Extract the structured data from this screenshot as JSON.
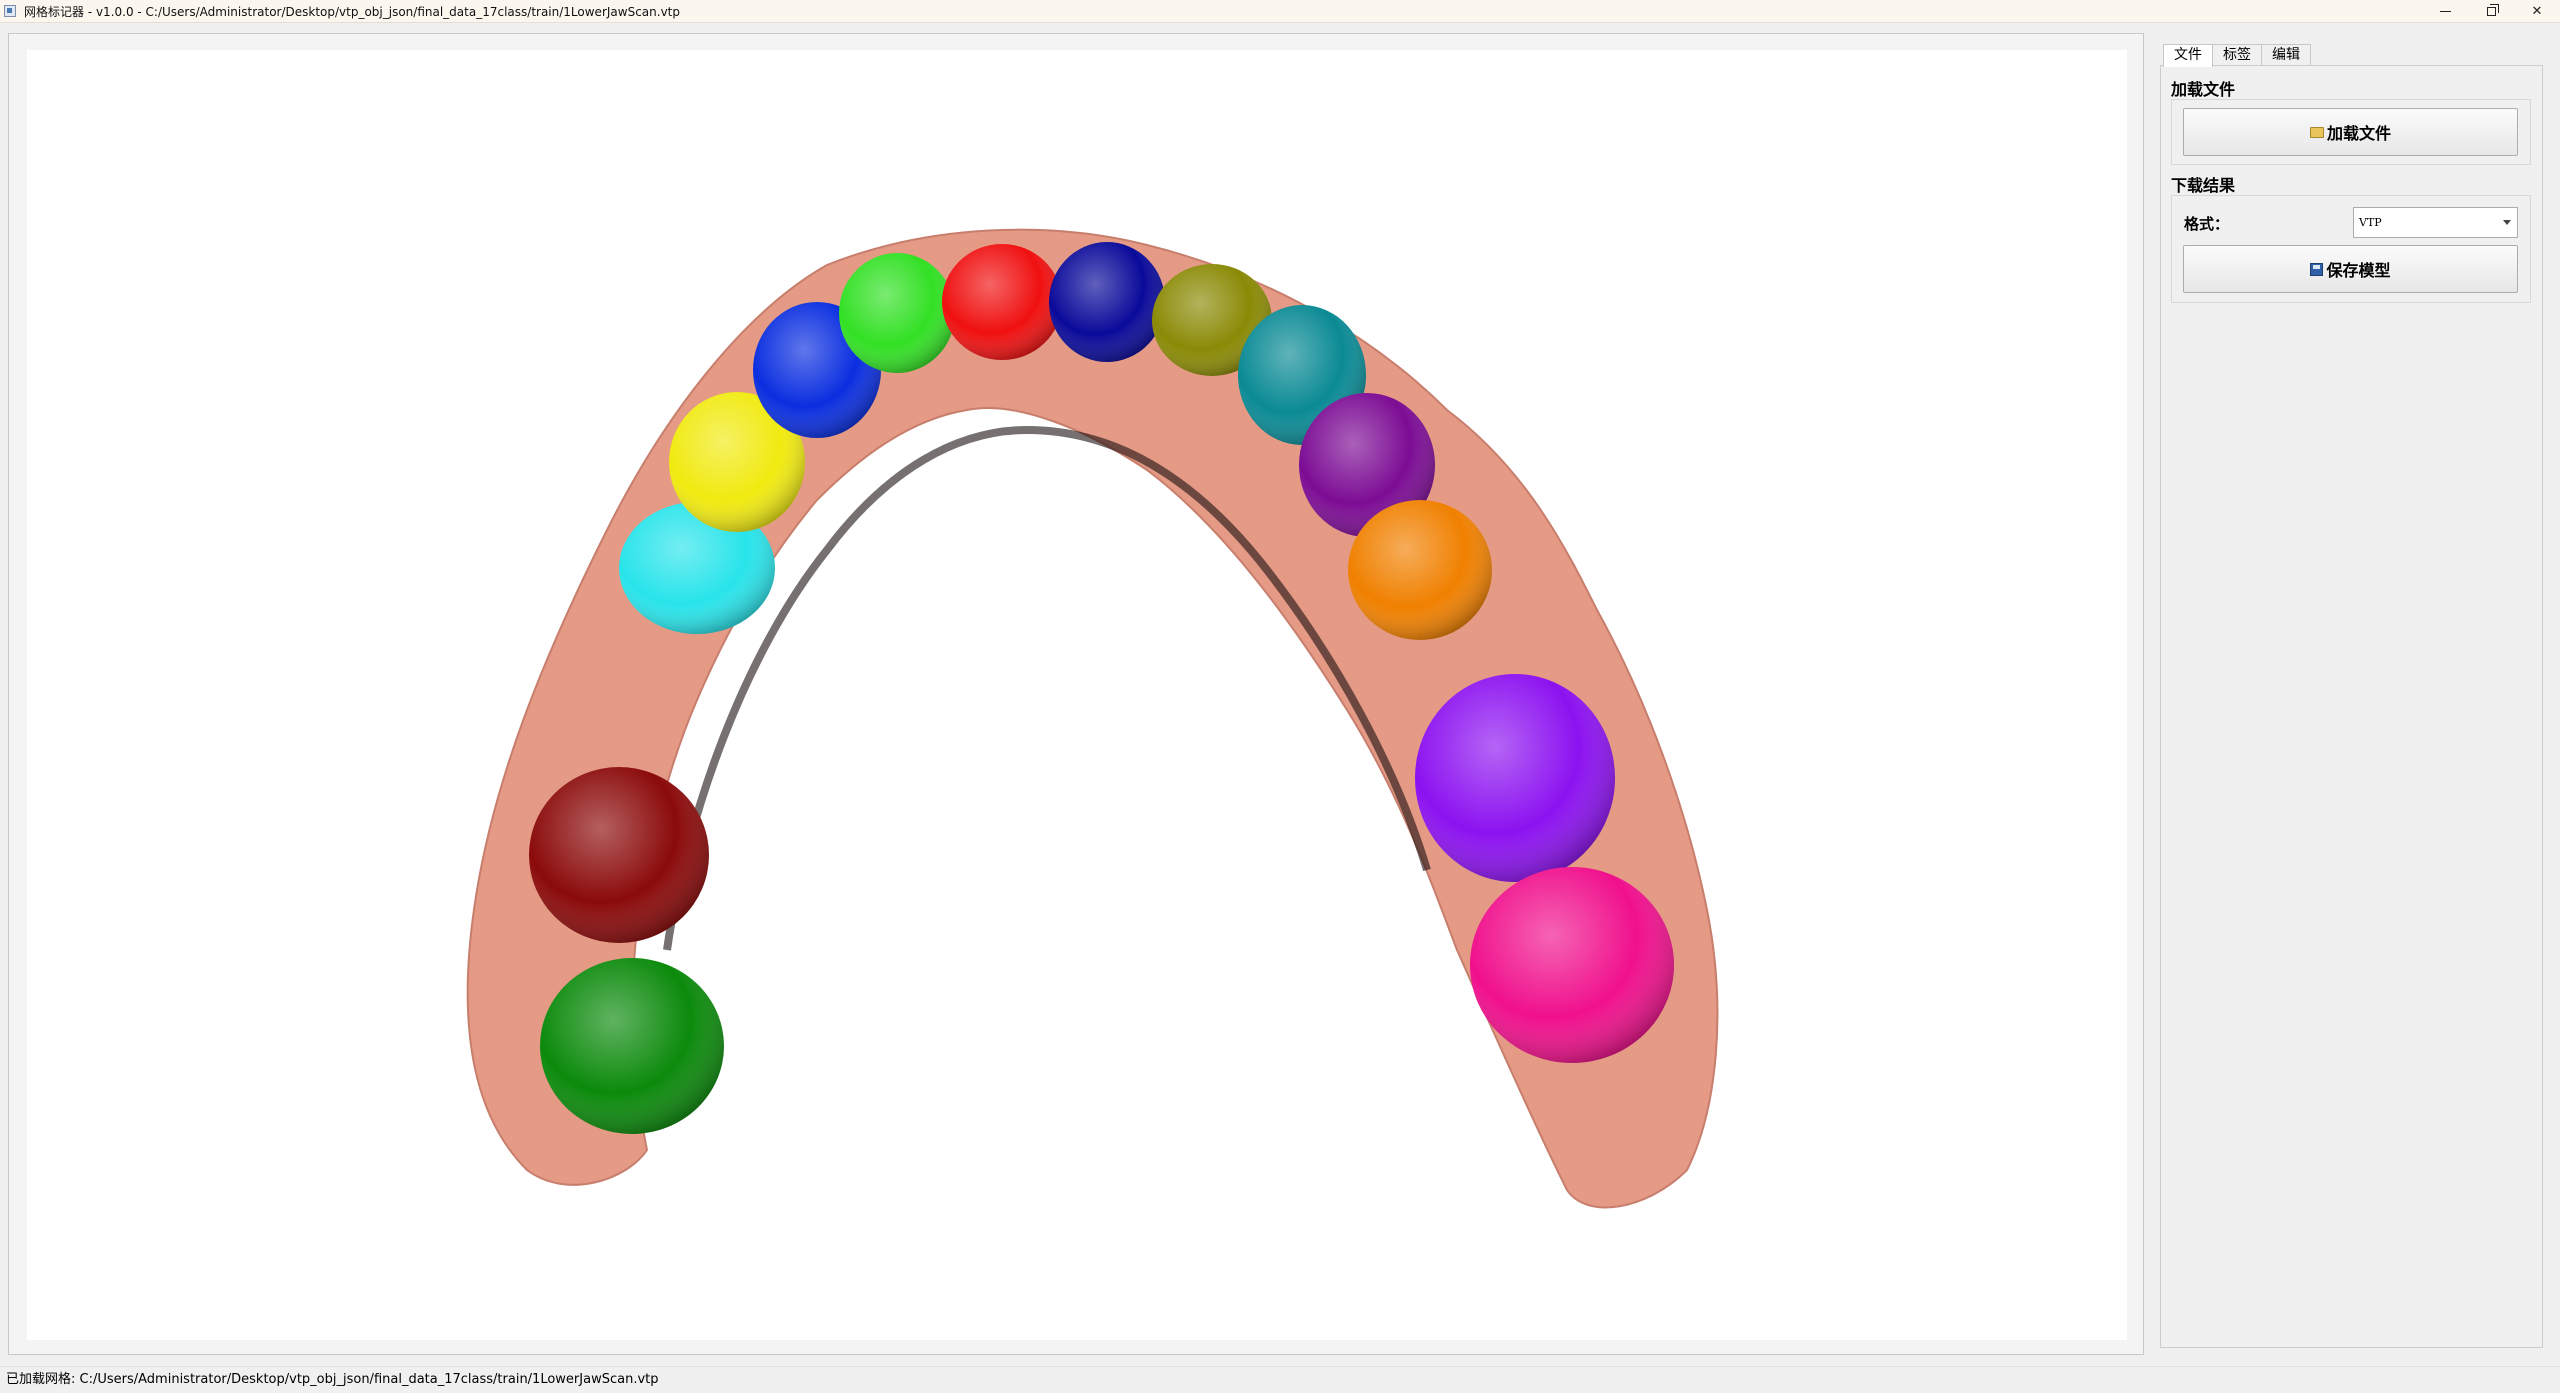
{
  "window": {
    "title": "网格标记器 - v1.0.0 - C:/Users/Administrator/Desktop/vtp_obj_json/final_data_17class/train/1LowerJawScan.vtp",
    "minimize_glyph": "—",
    "close_glyph": "✕"
  },
  "tabs": [
    {
      "label": "文件",
      "active": true
    },
    {
      "label": "标签",
      "active": false
    },
    {
      "label": "编辑",
      "active": false
    }
  ],
  "load_group": {
    "title": "加载文件",
    "button_label": "加载文件",
    "button_icon": "folder-open-icon"
  },
  "download_group": {
    "title": "下载结果",
    "format_label": "格式：",
    "format_value": "VTP",
    "save_button_label": "保存模型",
    "save_button_icon": "floppy-disk-icon"
  },
  "status": {
    "text": "已加载网格: C:/Users/Administrator/Desktop/vtp_obj_json/final_data_17class/train/1LowerJawScan.vtp"
  },
  "model": {
    "gum_color": "#e59a86",
    "tooth_colors": [
      "#0b8a0b",
      "#8b0a0a",
      "#28e4ea",
      "#f0ea10",
      "#0a2ee0",
      "#32e024",
      "#f01010",
      "#0a0a9a",
      "#8a8a06",
      "#0a8a94",
      "#7c0c94",
      "#f08000",
      "#8c12f0",
      "#f0108c"
    ]
  }
}
